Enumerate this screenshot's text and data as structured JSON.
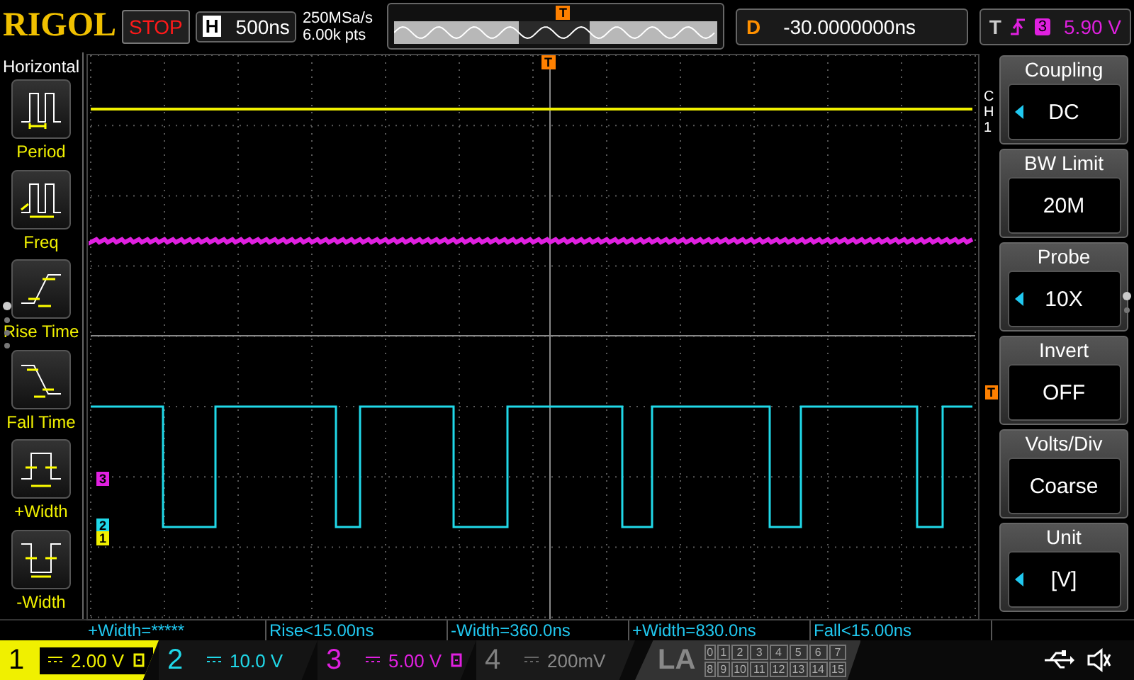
{
  "top_bar": {
    "logo": "RIGOL",
    "run_state": "STOP",
    "timebase_label": "H",
    "timebase": "500ns",
    "sample_rate": "250MSa/s",
    "memory_depth": "6.00k pts",
    "trigger_marker": "T",
    "delay_label": "D",
    "delay": "-30.0000000ns",
    "trigger_label": "T",
    "trigger_source": "3",
    "trigger_level": "5.90 V"
  },
  "left_menu": {
    "title": "Horizontal",
    "items": [
      {
        "kind": "period",
        "label": "Period"
      },
      {
        "kind": "freq",
        "label": "Freq"
      },
      {
        "kind": "rise",
        "label": "Rise Time"
      },
      {
        "kind": "fall",
        "label": "Fall Time"
      },
      {
        "kind": "pwidth",
        "label": "+Width"
      },
      {
        "kind": "nwidth",
        "label": "-Width"
      }
    ]
  },
  "plot": {
    "trigger_marker_top": "T",
    "trigger_marker_right": "T",
    "channel_markers": [
      {
        "label": "3",
        "color": "#e020e0",
        "kind": "ch3"
      },
      {
        "label": "2",
        "color": "#20d8e8",
        "kind": "ch2"
      },
      {
        "label": "1",
        "color": "#f0f000",
        "kind": "ch1"
      }
    ]
  },
  "right_menu": {
    "channel": "CH1",
    "items": [
      {
        "title": "Coupling",
        "value": "DC",
        "arrow": true
      },
      {
        "title": "BW Limit",
        "value": "20M",
        "arrow": false
      },
      {
        "title": "Probe",
        "value": "10X",
        "arrow": true
      },
      {
        "title": "Invert",
        "value": "OFF",
        "arrow": false
      },
      {
        "title": "Volts/Div",
        "value": "Coarse",
        "arrow": false
      },
      {
        "title": "Unit",
        "value": "[V]",
        "arrow": true
      }
    ]
  },
  "measurements": [
    "+Width=*****",
    "Rise<15.00ns",
    "-Width=360.0ns",
    "+Width=830.0ns",
    "Fall<15.00ns"
  ],
  "channels": [
    {
      "number": "1",
      "scale": "2.00 V",
      "color": "#f0f000",
      "selected": true,
      "on": true
    },
    {
      "number": "2",
      "scale": "10.0 V",
      "color": "#20d8e8",
      "selected": false,
      "on": true
    },
    {
      "number": "3",
      "scale": "5.00 V",
      "color": "#e020e0",
      "selected": false,
      "on": true
    },
    {
      "number": "4",
      "scale": "200mV",
      "color": "#808080",
      "selected": false,
      "on": false
    }
  ],
  "logic": {
    "label": "LA",
    "bits": [
      "0",
      "1",
      "2",
      "3",
      "4",
      "5",
      "6",
      "7",
      "8",
      "9",
      "10",
      "11",
      "12",
      "13",
      "14",
      "15"
    ]
  }
}
